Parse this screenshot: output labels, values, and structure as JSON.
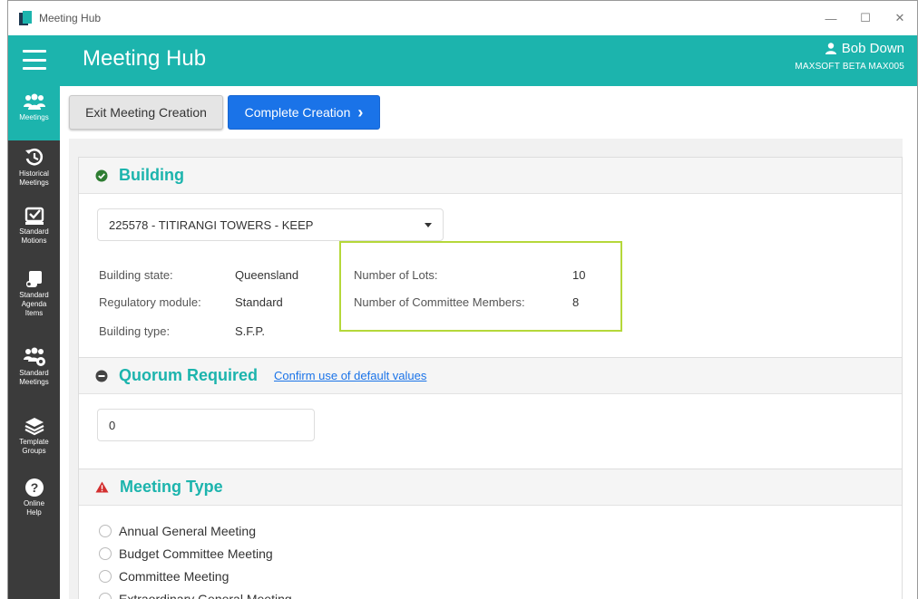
{
  "window": {
    "title": "Meeting Hub",
    "controls": [
      "—",
      "☐",
      "✕"
    ]
  },
  "header": {
    "app_name": "Meeting Hub",
    "user_name": "Bob Down",
    "user_sub": "MAXSOFT BETA MAX005",
    "accent": "#1cb4ad"
  },
  "sidebar": {
    "items": [
      {
        "label_1": "Meetings",
        "label_2": "",
        "label_3": "",
        "icon": "meetings-icon"
      },
      {
        "label_1": "Historical",
        "label_2": "Meetings",
        "label_3": "",
        "icon": "history-icon"
      },
      {
        "label_1": "Standard",
        "label_2": "Motions",
        "label_3": "",
        "icon": "motions-icon"
      },
      {
        "label_1": "Standard",
        "label_2": "Agenda",
        "label_3": "Items",
        "icon": "agenda-icon"
      },
      {
        "label_1": "Standard",
        "label_2": "Meetings",
        "label_3": "",
        "icon": "standard-meetings-icon"
      },
      {
        "label_1": "Template",
        "label_2": "Groups",
        "label_3": "",
        "icon": "layers-icon"
      },
      {
        "label_1": "Online",
        "label_2": "Help",
        "label_3": "",
        "icon": "help-icon"
      }
    ]
  },
  "toolbar": {
    "exit_label": "Exit Meeting Creation",
    "complete_label": "Complete Creation",
    "complete_arrow": "›"
  },
  "building": {
    "title": "Building",
    "selected": "225578 - TITIRANGI TOWERS - KEEP",
    "labels": [
      "Building state:",
      "Regulatory module:",
      "Building type:"
    ],
    "values": [
      "Queensland",
      "Standard",
      "S.F.P."
    ],
    "lot_label": "Number of Lots:",
    "lot_value": "10",
    "committee_label": "Number of Committee Members:",
    "committee_value": "8"
  },
  "quorum": {
    "title": "Quorum Required",
    "link": "Confirm use of default values",
    "value": "0"
  },
  "meeting_type": {
    "title": "Meeting Type",
    "options": [
      "Annual General Meeting",
      "Budget Committee Meeting",
      "Committee Meeting",
      "Extraordinary General Meeting"
    ]
  }
}
